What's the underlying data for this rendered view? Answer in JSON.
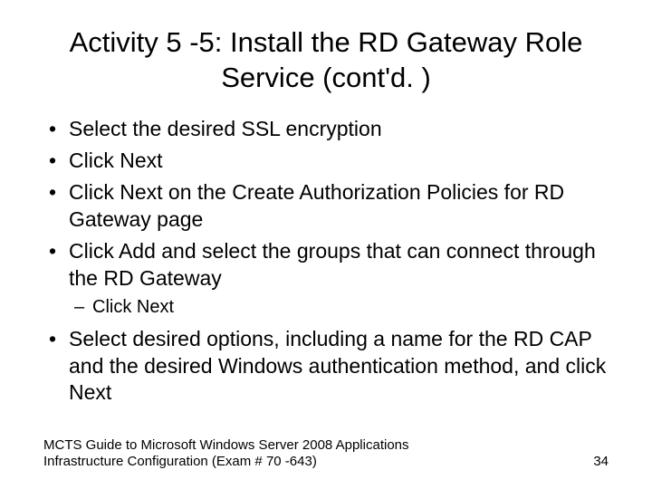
{
  "title": "Activity 5 -5: Install the RD Gateway Role Service (cont'd. )",
  "bullets": [
    {
      "text": "Select the desired SSL encryption"
    },
    {
      "text": "Click Next"
    },
    {
      "text": "Click Next on the Create Authorization Policies for RD Gateway page"
    },
    {
      "text": "Click Add and select the groups that can connect through the RD Gateway",
      "sub": [
        {
          "text": "Click Next"
        }
      ]
    },
    {
      "text": "Select desired options, including a name for the RD CAP and the desired Windows authentication method, and click Next"
    }
  ],
  "footer": {
    "left": "MCTS Guide to Microsoft Windows Server 2008 Applications Infrastructure Configuration (Exam # 70 -643)",
    "page": "34"
  }
}
